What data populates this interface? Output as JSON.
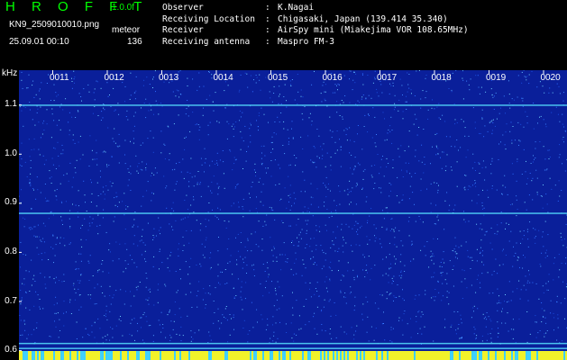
{
  "header": {
    "app_title": "H R O F F T",
    "version": "1.0.0f",
    "file_name": "KN9_2509010010.png",
    "mode": "meteor",
    "datetime": "25.09.01 00:10",
    "count": "136"
  },
  "info": [
    {
      "key": "Observer",
      "sep": ":",
      "value": "K.Nagai"
    },
    {
      "key": "Receiving Location",
      "sep": ":",
      "value": "Chigasaki, Japan (139.414 35.340)"
    },
    {
      "key": "Receiver",
      "sep": ":",
      "value": "AirSpy mini (Miakejima VOR 108.65MHz)"
    },
    {
      "key": "Receiving antenna",
      "sep": ":",
      "value": "Maspro FM-3"
    }
  ],
  "spectrogram": {
    "unit": "kHz",
    "y_ticks": [
      "1.1",
      "1.0",
      "0.9",
      "0.8",
      "0.7",
      "0.6"
    ],
    "y_tick_values": [
      1.1,
      1.0,
      0.9,
      0.8,
      0.7,
      0.6
    ],
    "y_range": [
      0.58,
      1.17
    ],
    "time_ticks": [
      "0011",
      "0012",
      "0013",
      "0014",
      "0015",
      "0016",
      "0017",
      "0018",
      "0019",
      "0020"
    ],
    "horizontal_lines_khz": [
      1.1,
      0.88,
      0.615,
      0.605
    ],
    "colors": {
      "background": "#0a1f9a",
      "noise": "#2d6cff",
      "line": "#56e0ff",
      "band": "#f2f22a"
    }
  }
}
